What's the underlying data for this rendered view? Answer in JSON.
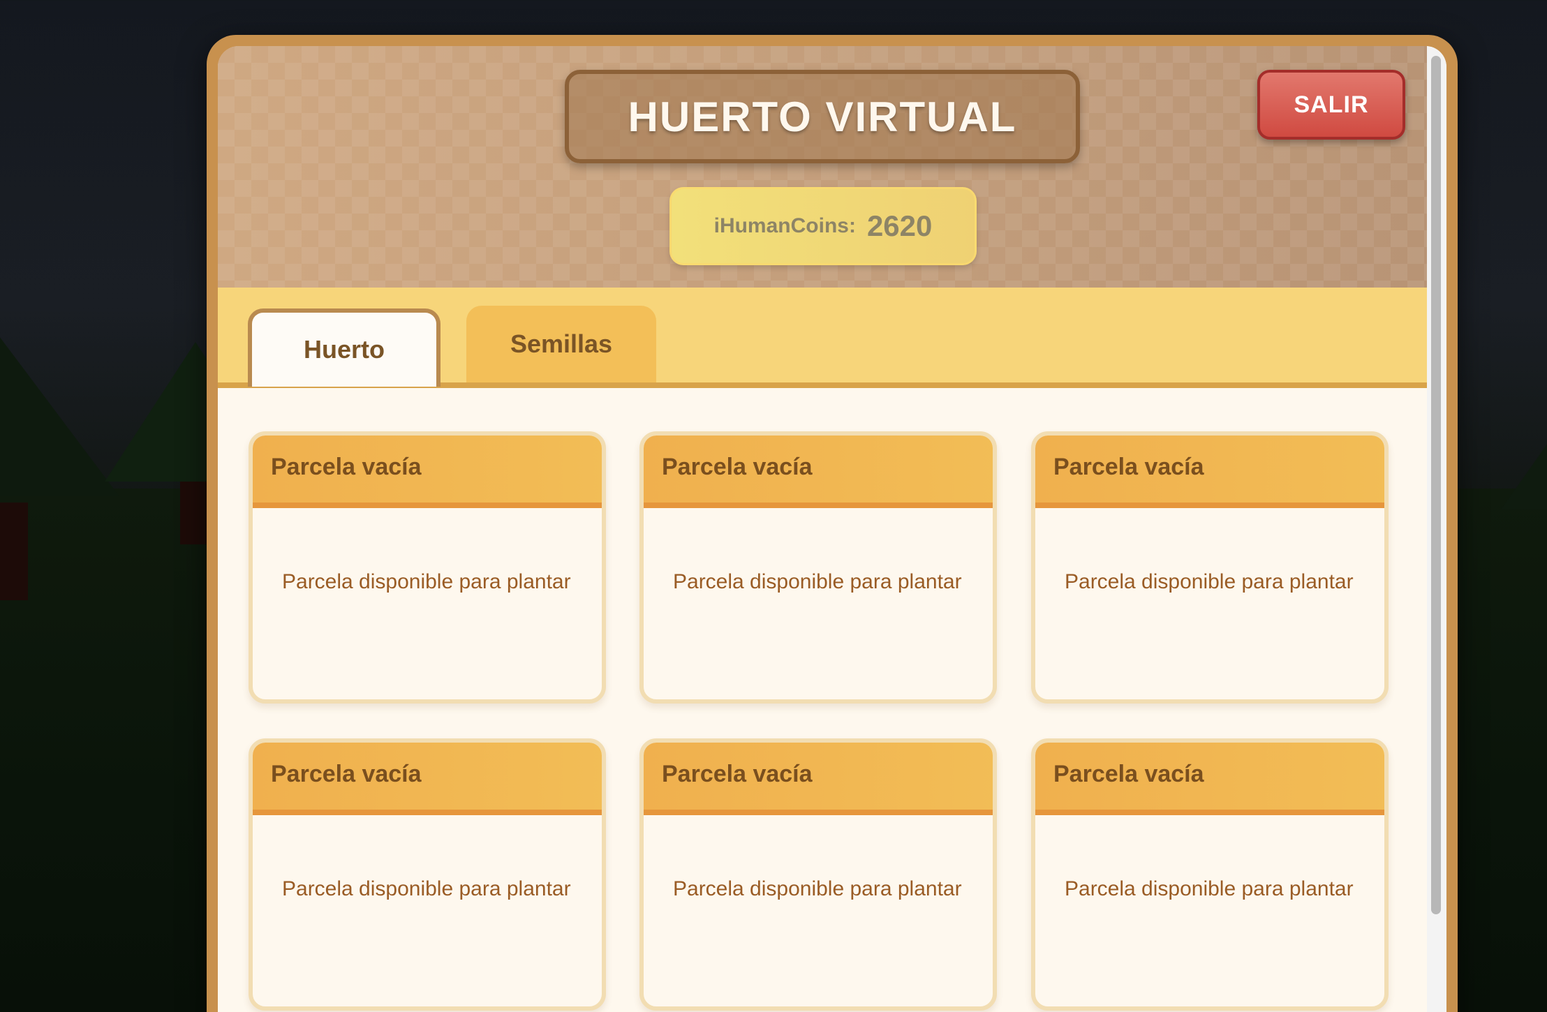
{
  "header": {
    "title": "HUERTO VIRTUAL",
    "coins_label": "iHumanCoins:",
    "coins_value": "2620",
    "exit_label": "SALIR"
  },
  "tabs": [
    {
      "label": "Huerto",
      "active": true
    },
    {
      "label": "Semillas",
      "active": false
    }
  ],
  "plots": [
    {
      "title": "Parcela vacía",
      "description": "Parcela disponible para plantar"
    },
    {
      "title": "Parcela vacía",
      "description": "Parcela disponible para plantar"
    },
    {
      "title": "Parcela vacía",
      "description": "Parcela disponible para plantar"
    },
    {
      "title": "Parcela vacía",
      "description": "Parcela disponible para plantar"
    },
    {
      "title": "Parcela vacía",
      "description": "Parcela disponible para plantar"
    },
    {
      "title": "Parcela vacía",
      "description": "Parcela disponible para plantar"
    }
  ],
  "colors": {
    "panel_border": "#c8914e",
    "tab_bar": "#f7d57a",
    "plot_header": "#f0b04e",
    "exit_button": "#d04a41"
  }
}
